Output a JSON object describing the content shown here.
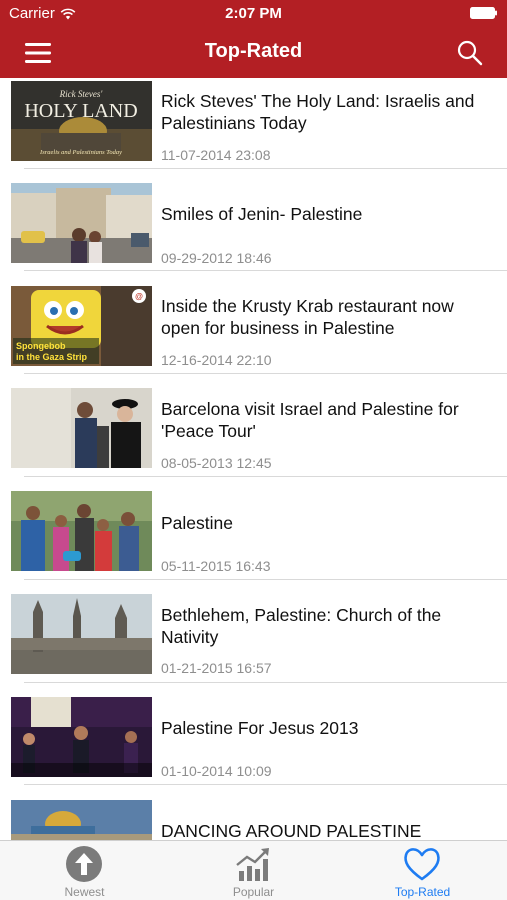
{
  "status_bar": {
    "carrier": "Carrier",
    "time": "2:07 PM"
  },
  "nav": {
    "title": "Top-Rated",
    "bar_color": "#b31f24"
  },
  "videos": [
    {
      "title": "Rick Steves' The Holy Land: Israelis and Palestinians Today",
      "date": "11-07-2014 23:08",
      "thumb_text": "Rick Steves' HOLY LAND Israelis and Palestinians Today"
    },
    {
      "title": "Smiles of Jenin- Palestine",
      "date": "09-29-2012 18:46"
    },
    {
      "title": "Inside the Krusty Krab restaurant now open for business in Palestine",
      "date": "12-16-2014 22:10",
      "thumb_text": "Spongebob in the Gaza Strip"
    },
    {
      "title": "Barcelona visit Israel and Palestine for 'Peace Tour'",
      "date": "08-05-2013 12:45"
    },
    {
      "title": "Palestine",
      "date": "05-11-2015 16:43"
    },
    {
      "title": "Bethlehem, Palestine: Church of the Nativity",
      "date": "01-21-2015 16:57"
    },
    {
      "title": "Palestine For Jesus 2013",
      "date": "01-10-2014 10:09"
    },
    {
      "title": "DANCING AROUND PALESTINE",
      "date": ""
    }
  ],
  "tabs": [
    {
      "label": "Newest",
      "icon": "arrow-up-circle-icon"
    },
    {
      "label": "Popular",
      "icon": "bar-chart-trend-icon"
    },
    {
      "label": "Top-Rated",
      "icon": "heart-icon",
      "active": true
    }
  ],
  "colors": {
    "active_tab": "#1e7cf2",
    "inactive_tab": "#8e8e8e"
  }
}
